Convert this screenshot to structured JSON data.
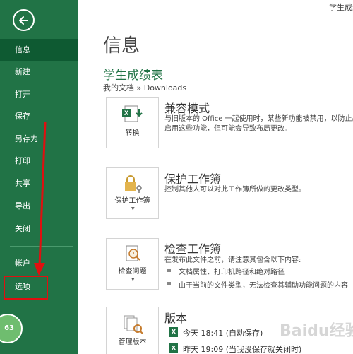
{
  "window": {
    "title": "学生成绩"
  },
  "sidebar": {
    "items": [
      {
        "label": "信息"
      },
      {
        "label": "新建"
      },
      {
        "label": "打开"
      },
      {
        "label": "保存"
      },
      {
        "label": "另存为"
      },
      {
        "label": "打印"
      },
      {
        "label": "共享"
      },
      {
        "label": "导出"
      },
      {
        "label": "关闭"
      },
      {
        "label": "帐户"
      },
      {
        "label": "选项"
      }
    ],
    "badge": "63"
  },
  "main": {
    "title": "信息",
    "doc_name": "学生成绩表",
    "breadcrumb": "我的文档 » Downloads",
    "sections": [
      {
        "title": "兼容模式",
        "button_label": "转换",
        "desc_lines": [
          "与旧版本的 Office 一起使用时，某些新功能被禁用，以防止出",
          "启用这些功能，但可能会导致布局更改。"
        ]
      },
      {
        "title": "保护工作簿",
        "button_label": "保护工作簿",
        "desc_lines": [
          "控制其他人可以对此工作簿所做的更改类型。"
        ]
      },
      {
        "title": "检查工作簿",
        "button_label": "检查问题",
        "desc_lines": [
          "在发布此文件之前，请注意其包含以下内容:"
        ],
        "bullets": [
          "文档属性、打印机路径和绝对路径",
          "由于当前的文件类型，无法检查其辅助功能问题的内容"
        ]
      },
      {
        "title": "版本",
        "button_label": "管理版本",
        "versions": [
          "今天 18:41 (自动保存)",
          "昨天 19:09 (当我没保存就关闭时)"
        ]
      }
    ]
  },
  "watermark": "Baidu经验",
  "colors": {
    "sidebar_bg": "#217346",
    "active_bg": "#0e5a32",
    "accent": "#217346",
    "annotation": "#e01010"
  },
  "icons": [
    "back-arrow-icon",
    "excel-convert-icon",
    "lock-key-icon",
    "inspect-document-icon",
    "manage-versions-icon",
    "excel-file-icon"
  ]
}
